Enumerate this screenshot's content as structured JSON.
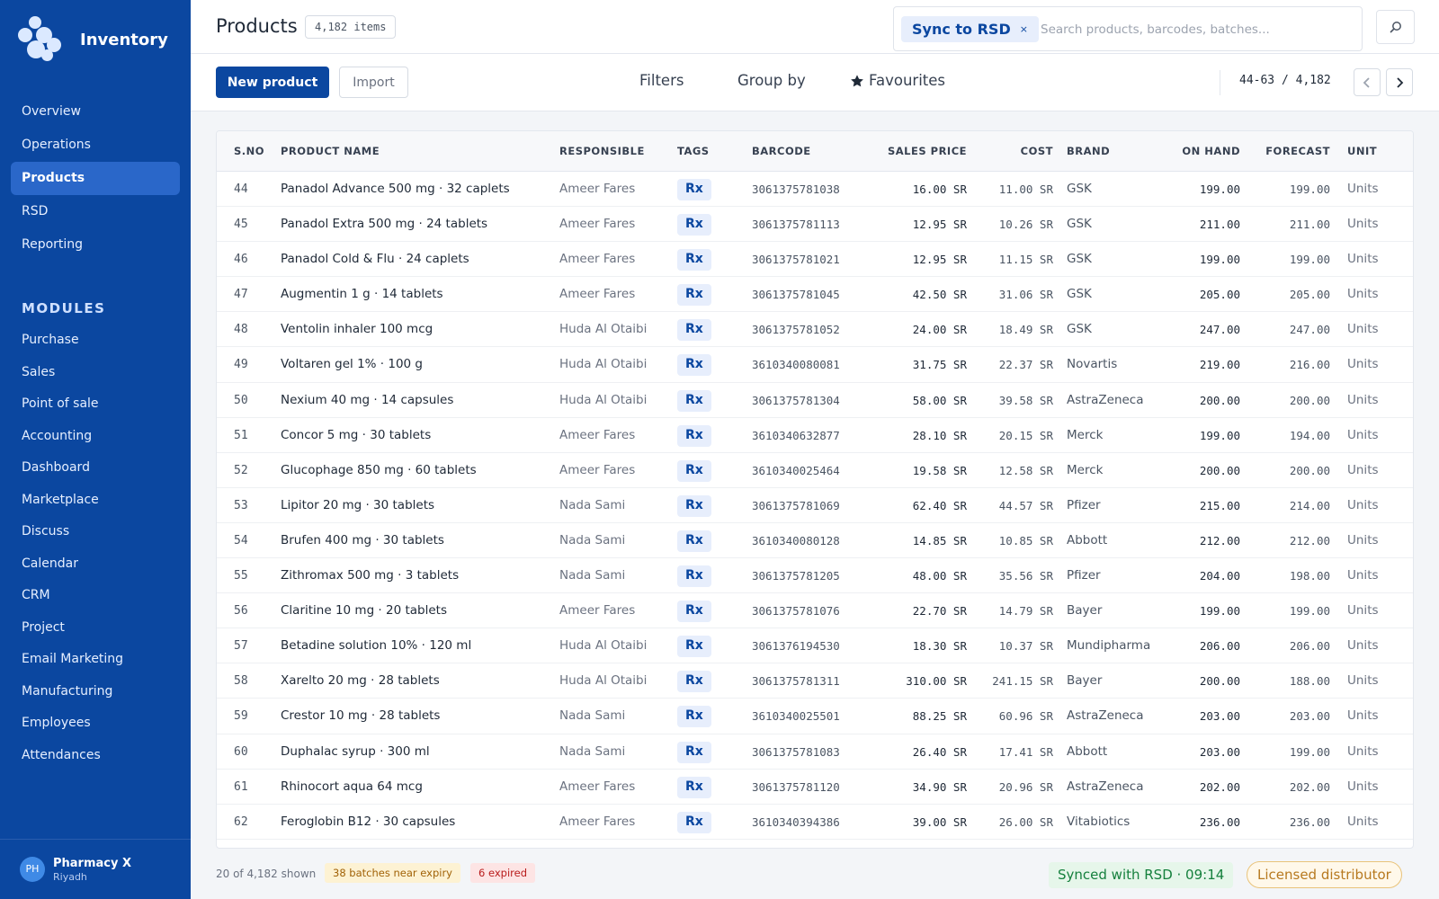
{
  "app": {
    "name": "Inventory"
  },
  "sidebar": {
    "items": [
      {
        "label": "Overview",
        "active": false
      },
      {
        "label": "Operations",
        "active": false
      },
      {
        "label": "Products",
        "active": true
      },
      {
        "label": "RSD",
        "active": false
      },
      {
        "label": "Reporting",
        "active": false
      }
    ],
    "modules_heading": "MODULES",
    "modules": [
      "Purchase",
      "Sales",
      "Point of sale",
      "Accounting",
      "Dashboard",
      "Marketplace",
      "Discuss",
      "Calendar",
      "CRM",
      "Project",
      "Email Marketing",
      "Manufacturing",
      "Employees",
      "Attendances"
    ],
    "user": {
      "initials": "PH",
      "name": "Pharmacy X",
      "location": "Riyadh"
    }
  },
  "header": {
    "title": "Products",
    "count_badge": "4,182 items",
    "search": {
      "chip_label": "Sync to RSD",
      "chip_close": "×",
      "placeholder": "Search products, barcodes, batches..."
    }
  },
  "toolbar": {
    "new_label": "New product",
    "import_label": "Import",
    "filters_label": "Filters",
    "groupby_label": "Group by",
    "favourites_label": "Favourites",
    "pager": "44-63 / 4,182"
  },
  "table": {
    "columns": {
      "sno": "S.NO",
      "name": "PRODUCT NAME",
      "responsible": "RESPONSIBLE",
      "tags": "TAGS",
      "barcode": "BARCODE",
      "sales_price": "SALES PRICE",
      "cost": "COST",
      "brand": "BRAND",
      "on_hand": "ON HAND",
      "forecast": "FORECAST",
      "unit": "UNIT"
    },
    "rows": [
      {
        "sno": "44",
        "name": "Panadol Advance 500 mg · 32 caplets",
        "responsible": "Ameer Fares",
        "tag": "Rx",
        "barcode": "3061375781038",
        "price": "16.00 SR",
        "cost": "11.00 SR",
        "brand": "GSK",
        "on_hand": "199.00",
        "forecast": "199.00",
        "unit": "Units"
      },
      {
        "sno": "45",
        "name": "Panadol Extra 500 mg · 24 tablets",
        "responsible": "Ameer Fares",
        "tag": "Rx",
        "barcode": "3061375781113",
        "price": "12.95 SR",
        "cost": "10.26 SR",
        "brand": "GSK",
        "on_hand": "211.00",
        "forecast": "211.00",
        "unit": "Units"
      },
      {
        "sno": "46",
        "name": "Panadol Cold & Flu · 24 caplets",
        "responsible": "Ameer Fares",
        "tag": "Rx",
        "barcode": "3061375781021",
        "price": "12.95 SR",
        "cost": "11.15 SR",
        "brand": "GSK",
        "on_hand": "199.00",
        "forecast": "199.00",
        "unit": "Units"
      },
      {
        "sno": "47",
        "name": "Augmentin 1 g · 14 tablets",
        "responsible": "Ameer Fares",
        "tag": "Rx",
        "barcode": "3061375781045",
        "price": "42.50 SR",
        "cost": "31.06 SR",
        "brand": "GSK",
        "on_hand": "205.00",
        "forecast": "205.00",
        "unit": "Units"
      },
      {
        "sno": "48",
        "name": "Ventolin inhaler 100 mcg",
        "responsible": "Huda Al Otaibi",
        "tag": "Rx",
        "barcode": "3061375781052",
        "price": "24.00 SR",
        "cost": "18.49 SR",
        "brand": "GSK",
        "on_hand": "247.00",
        "forecast": "247.00",
        "unit": "Units"
      },
      {
        "sno": "49",
        "name": "Voltaren gel 1% · 100 g",
        "responsible": "Huda Al Otaibi",
        "tag": "Rx",
        "barcode": "3610340080081",
        "price": "31.75 SR",
        "cost": "22.37 SR",
        "brand": "Novartis",
        "on_hand": "219.00",
        "forecast": "216.00",
        "unit": "Units"
      },
      {
        "sno": "50",
        "name": "Nexium 40 mg · 14 capsules",
        "responsible": "Huda Al Otaibi",
        "tag": "Rx",
        "barcode": "3061375781304",
        "price": "58.00 SR",
        "cost": "39.58 SR",
        "brand": "AstraZeneca",
        "on_hand": "200.00",
        "forecast": "200.00",
        "unit": "Units"
      },
      {
        "sno": "51",
        "name": "Concor 5 mg · 30 tablets",
        "responsible": "Ameer Fares",
        "tag": "Rx",
        "barcode": "3610340632877",
        "price": "28.10 SR",
        "cost": "20.15 SR",
        "brand": "Merck",
        "on_hand": "199.00",
        "forecast": "194.00",
        "unit": "Units"
      },
      {
        "sno": "52",
        "name": "Glucophage 850 mg · 60 tablets",
        "responsible": "Ameer Fares",
        "tag": "Rx",
        "barcode": "3610340025464",
        "price": "19.58 SR",
        "cost": "12.58 SR",
        "brand": "Merck",
        "on_hand": "200.00",
        "forecast": "200.00",
        "unit": "Units"
      },
      {
        "sno": "53",
        "name": "Lipitor 20 mg · 30 tablets",
        "responsible": "Nada Sami",
        "tag": "Rx",
        "barcode": "3061375781069",
        "price": "62.40 SR",
        "cost": "44.57 SR",
        "brand": "Pfizer",
        "on_hand": "215.00",
        "forecast": "214.00",
        "unit": "Units"
      },
      {
        "sno": "54",
        "name": "Brufen 400 mg · 30 tablets",
        "responsible": "Nada Sami",
        "tag": "Rx",
        "barcode": "3610340080128",
        "price": "14.85 SR",
        "cost": "10.85 SR",
        "brand": "Abbott",
        "on_hand": "212.00",
        "forecast": "212.00",
        "unit": "Units"
      },
      {
        "sno": "55",
        "name": "Zithromax 500 mg · 3 tablets",
        "responsible": "Nada Sami",
        "tag": "Rx",
        "barcode": "3061375781205",
        "price": "48.00 SR",
        "cost": "35.56 SR",
        "brand": "Pfizer",
        "on_hand": "204.00",
        "forecast": "198.00",
        "unit": "Units"
      },
      {
        "sno": "56",
        "name": "Claritine 10 mg · 20 tablets",
        "responsible": "Ameer Fares",
        "tag": "Rx",
        "barcode": "3061375781076",
        "price": "22.70 SR",
        "cost": "14.79 SR",
        "brand": "Bayer",
        "on_hand": "199.00",
        "forecast": "199.00",
        "unit": "Units"
      },
      {
        "sno": "57",
        "name": "Betadine solution 10% · 120 ml",
        "responsible": "Huda Al Otaibi",
        "tag": "Rx",
        "barcode": "3061376194530",
        "price": "18.30 SR",
        "cost": "10.37 SR",
        "brand": "Mundipharma",
        "on_hand": "206.00",
        "forecast": "206.00",
        "unit": "Units"
      },
      {
        "sno": "58",
        "name": "Xarelto 20 mg · 28 tablets",
        "responsible": "Huda Al Otaibi",
        "tag": "Rx",
        "barcode": "3061375781311",
        "price": "310.00 SR",
        "cost": "241.15 SR",
        "brand": "Bayer",
        "on_hand": "200.00",
        "forecast": "188.00",
        "unit": "Units"
      },
      {
        "sno": "59",
        "name": "Crestor 10 mg · 28 tablets",
        "responsible": "Nada Sami",
        "tag": "Rx",
        "barcode": "3610340025501",
        "price": "88.25 SR",
        "cost": "60.96 SR",
        "brand": "AstraZeneca",
        "on_hand": "203.00",
        "forecast": "203.00",
        "unit": "Units"
      },
      {
        "sno": "60",
        "name": "Duphalac syrup · 300 ml",
        "responsible": "Nada Sami",
        "tag": "Rx",
        "barcode": "3061375781083",
        "price": "26.40 SR",
        "cost": "17.41 SR",
        "brand": "Abbott",
        "on_hand": "203.00",
        "forecast": "199.00",
        "unit": "Units"
      },
      {
        "sno": "61",
        "name": "Rhinocort aqua 64 mcg",
        "responsible": "Ameer Fares",
        "tag": "Rx",
        "barcode": "3061375781120",
        "price": "34.90 SR",
        "cost": "20.96 SR",
        "brand": "AstraZeneca",
        "on_hand": "202.00",
        "forecast": "202.00",
        "unit": "Units"
      },
      {
        "sno": "62",
        "name": "Feroglobin B12 · 30 capsules",
        "responsible": "Ameer Fares",
        "tag": "Rx",
        "barcode": "3610340394386",
        "price": "39.00 SR",
        "cost": "26.00 SR",
        "brand": "Vitabiotics",
        "on_hand": "236.00",
        "forecast": "236.00",
        "unit": "Units"
      }
    ]
  },
  "footer": {
    "shown": "20 of 4,182 shown",
    "near_expiry": "38 batches near expiry",
    "expired": "6 expired",
    "synced": "Synced with RSD · 09:14",
    "licensed": "Licensed distributor"
  },
  "colors": {
    "brand": "#0b47a0",
    "accent_tag": "#e7eefc",
    "warn": "#fdf2d3",
    "danger": "#fde4e4",
    "success": "#e6f6ea"
  }
}
